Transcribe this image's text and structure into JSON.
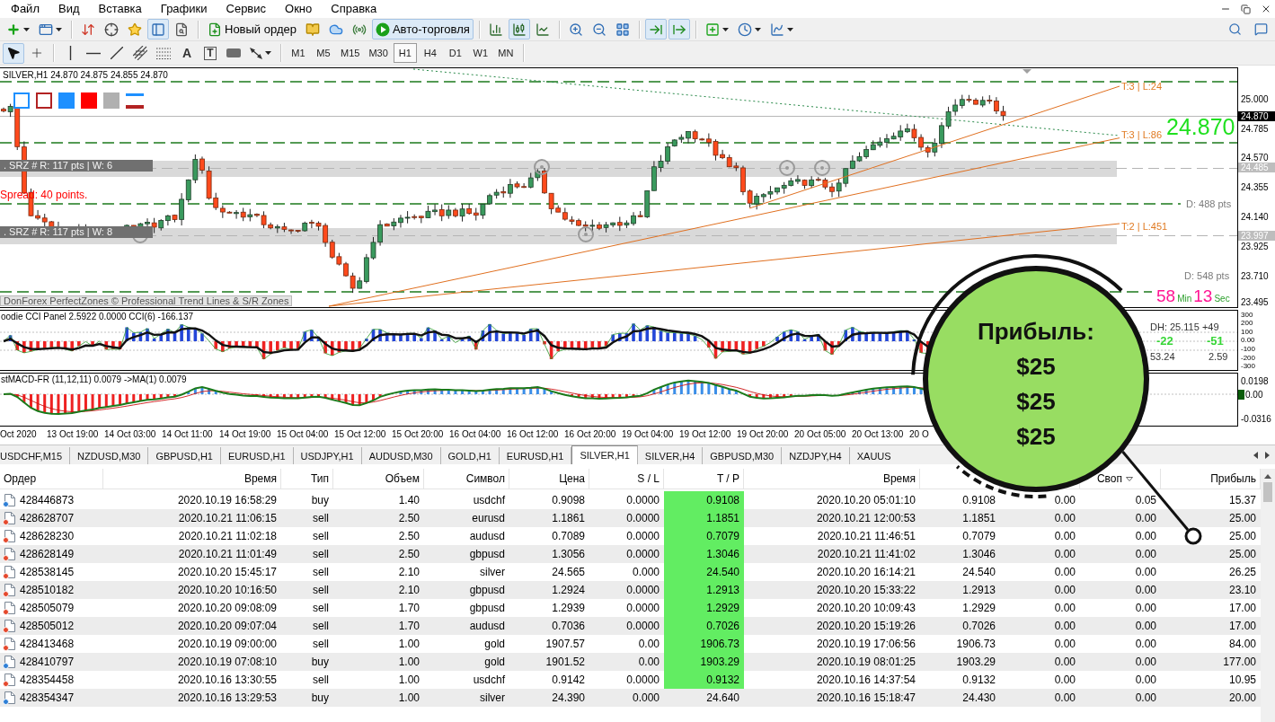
{
  "menu": [
    "Файл",
    "Вид",
    "Вставка",
    "Графики",
    "Сервис",
    "Окно",
    "Справка"
  ],
  "main_toolbar": [
    [
      {
        "kind": "dropdown",
        "pressed": false
      },
      {
        "kind": "dropdown",
        "pressed": false
      }
    ],
    [
      {
        "kind": "icon",
        "pressed": false
      },
      {
        "kind": "icon",
        "pressed": false
      },
      {
        "kind": "icon",
        "pressed": false
      },
      {
        "kind": "icon",
        "pressed": true
      },
      {
        "kind": "icon",
        "pressed": false
      }
    ],
    [
      {
        "kind": "labeled",
        "label": "Новый ордер",
        "pressed": false
      },
      {
        "kind": "icon",
        "pressed": false
      },
      {
        "kind": "icon",
        "pressed": false
      },
      {
        "kind": "icon",
        "pressed": false
      },
      {
        "kind": "labeled",
        "label": "Авто-торговля",
        "pressed": true
      }
    ],
    [
      {
        "kind": "icon",
        "pressed": false
      },
      {
        "kind": "icon",
        "pressed": true
      },
      {
        "kind": "icon",
        "pressed": false
      }
    ],
    [
      {
        "kind": "icon",
        "pressed": false
      },
      {
        "kind": "icon",
        "pressed": false
      },
      {
        "kind": "icon",
        "pressed": false
      }
    ],
    [
      {
        "kind": "icon",
        "pressed": true
      },
      {
        "kind": "icon",
        "pressed": true
      }
    ],
    [
      {
        "kind": "dropdown",
        "pressed": false
      },
      {
        "kind": "dropdown",
        "pressed": false
      },
      {
        "kind": "dropdown",
        "pressed": false
      }
    ]
  ],
  "drawing_toolbar": [
    [
      {
        "kind": "icon",
        "pressed": true
      },
      {
        "kind": "icon",
        "pressed": false
      }
    ],
    [
      {
        "kind": "icon",
        "pressed": false
      },
      {
        "kind": "icon",
        "pressed": false
      },
      {
        "kind": "icon",
        "pressed": false
      },
      {
        "kind": "icon",
        "pressed": false
      },
      {
        "kind": "icon",
        "pressed": false
      },
      {
        "kind": "glyph",
        "label": "A",
        "pressed": false
      },
      {
        "kind": "boxed_glyph",
        "label": "T",
        "pressed": false
      },
      {
        "kind": "icon",
        "pressed": false
      },
      {
        "kind": "dropdown",
        "pressed": false
      }
    ]
  ],
  "timeframes": [
    {
      "label": "M1",
      "selected": false
    },
    {
      "label": "M5",
      "selected": false
    },
    {
      "label": "M15",
      "selected": false
    },
    {
      "label": "M30",
      "selected": false
    },
    {
      "label": "H1",
      "selected": true
    },
    {
      "label": "H4",
      "selected": false
    },
    {
      "label": "D1",
      "selected": false
    },
    {
      "label": "W1",
      "selected": false
    },
    {
      "label": "MN",
      "selected": false
    }
  ],
  "chart": {
    "title": "SILVER,H1 24.870 24.875 24.855 24.870",
    "zones": [
      ". SRZ # R: 117 pts | W: 6",
      ". SRZ # R: 117 pts | W: 8"
    ],
    "spread": "Spread: 40 points.",
    "credit": "DonForex PerfectZones © Professional Trend Lines & S/R Zones",
    "trend_labels": [
      "T:3 | L:24",
      "T:3 | L:86",
      "T:2 | L:451"
    ],
    "current_price": "24.870",
    "distance_labels": [
      "D: 488 pts",
      "D: 548 pts"
    ],
    "countdown": {
      "minutes": "58",
      "minutes_unit": "Min",
      "seconds": "13",
      "seconds_unit": "Sec"
    },
    "price_axis": [
      {
        "label": "25.000",
        "kind": "tick"
      },
      {
        "label": "24.870",
        "kind": "bid"
      },
      {
        "label": "24.785",
        "kind": "tick"
      },
      {
        "label": "24.570",
        "kind": "tick"
      },
      {
        "label": "24.485",
        "kind": "zone"
      },
      {
        "label": "24.355",
        "kind": "tick"
      },
      {
        "label": "24.140",
        "kind": "tick"
      },
      {
        "label": "23.997",
        "kind": "zone"
      },
      {
        "label": "23.925",
        "kind": "tick"
      },
      {
        "label": "23.710",
        "kind": "tick"
      },
      {
        "label": "23.495",
        "kind": "tick"
      }
    ]
  },
  "cci_panel": {
    "title": "oodie CCI Panel 2.5922 0.0000 CCI(6) -166.137",
    "axis": [
      "300",
      "200",
      "100",
      "0.00",
      "-100",
      "-200",
      "-300"
    ],
    "readouts": [
      {
        "text": "DH: 25.115 +49",
        "kind": "plain"
      },
      {
        "text": "-22",
        "kind": "signal"
      },
      {
        "text": "-51",
        "kind": "signal"
      },
      {
        "text": "53.24",
        "kind": "plain"
      },
      {
        "text": "2.59",
        "kind": "plain"
      }
    ]
  },
  "macd_panel": {
    "title": "stMACD-FR (11,12,11) 0.0079 ->MA(1) 0.0079",
    "axis": [
      {
        "label": "0.0198",
        "kind": "tick"
      },
      {
        "label": "0.00",
        "kind": "current"
      },
      {
        "label": "-0.0316",
        "kind": "tick"
      }
    ]
  },
  "time_axis": [
    "Oct 2020",
    "13 Oct 19:00",
    "14 Oct 03:00",
    "14 Oct 11:00",
    "14 Oct 19:00",
    "15 Oct 04:00",
    "15 Oct 12:00",
    "15 Oct 20:00",
    "16 Oct 04:00",
    "16 Oct 12:00",
    "16 Oct 20:00",
    "19 Oct 04:00",
    "19 Oct 12:00",
    "19 Oct 20:00",
    "20 Oct 05:00",
    "20 Oct 13:00",
    "20 O"
  ],
  "chart_tabs": [
    {
      "label": "USDCHF,M15",
      "selected": false
    },
    {
      "label": "NZDUSD,M30",
      "selected": false
    },
    {
      "label": "GBPUSD,H1",
      "selected": false
    },
    {
      "label": "EURUSD,H1",
      "selected": false
    },
    {
      "label": "USDJPY,H1",
      "selected": false
    },
    {
      "label": "AUDUSD,M30",
      "selected": false
    },
    {
      "label": "GOLD,H1",
      "selected": false
    },
    {
      "label": "EURUSD,H1",
      "selected": false
    },
    {
      "label": "SILVER,H1",
      "selected": true
    },
    {
      "label": "SILVER,H4",
      "selected": false
    },
    {
      "label": "GBPUSD,M30",
      "selected": false
    },
    {
      "label": "NZDJPY,H4",
      "selected": false
    },
    {
      "label": "XAUUS",
      "selected": false
    }
  ],
  "orders_table": {
    "columns": [
      {
        "label": "Ордер",
        "sorted": false
      },
      {
        "label": "Время",
        "sorted": false
      },
      {
        "label": "Тип",
        "sorted": false
      },
      {
        "label": "Объем",
        "sorted": false
      },
      {
        "label": "Символ",
        "sorted": false
      },
      {
        "label": "Цена",
        "sorted": false
      },
      {
        "label": "S / L",
        "sorted": false
      },
      {
        "label": "T / P",
        "sorted": false
      },
      {
        "label": "Время",
        "sorted": false
      },
      null,
      null,
      {
        "label": "Своп",
        "sorted": true
      },
      {
        "label": "Прибыль",
        "sorted": false
      }
    ],
    "rows": [
      {
        "cells": [
          "428446873",
          "2020.10.19 16:58:29",
          "buy",
          "1.40",
          "usdchf",
          "0.9098",
          "0.0000",
          "0.9108",
          "2020.10.20 05:01:10",
          "0.9108",
          "0.00",
          "0.05",
          "15.37"
        ],
        "color": "#2e7fd6",
        "tp_hit": true
      },
      {
        "cells": [
          "428628707",
          "2020.10.21 11:06:15",
          "sell",
          "2.50",
          "eurusd",
          "1.1861",
          "0.0000",
          "1.1851",
          "2020.10.21 12:00:53",
          "1.1851",
          "0.00",
          "0.00",
          "25.00"
        ],
        "color": "#e5482c",
        "tp_hit": true
      },
      {
        "cells": [
          "428628230",
          "2020.10.21 11:02:18",
          "sell",
          "2.50",
          "audusd",
          "0.7089",
          "0.0000",
          "0.7079",
          "2020.10.21 11:46:51",
          "0.7079",
          "0.00",
          "0.00",
          "25.00"
        ],
        "color": "#e5482c",
        "tp_hit": true
      },
      {
        "cells": [
          "428628149",
          "2020.10.21 11:01:49",
          "sell",
          "2.50",
          "gbpusd",
          "1.3056",
          "0.0000",
          "1.3046",
          "2020.10.21 11:41:02",
          "1.3046",
          "0.00",
          "0.00",
          "25.00"
        ],
        "color": "#e5482c",
        "tp_hit": true
      },
      {
        "cells": [
          "428538145",
          "2020.10.20 15:45:17",
          "sell",
          "2.10",
          "silver",
          "24.565",
          "0.000",
          "24.540",
          "2020.10.20 16:14:21",
          "24.540",
          "0.00",
          "0.00",
          "26.25"
        ],
        "color": "#e5482c",
        "tp_hit": true
      },
      {
        "cells": [
          "428510182",
          "2020.10.20 10:16:50",
          "sell",
          "2.10",
          "gbpusd",
          "1.2924",
          "0.0000",
          "1.2913",
          "2020.10.20 15:33:22",
          "1.2913",
          "0.00",
          "0.00",
          "23.10"
        ],
        "color": "#e5482c",
        "tp_hit": true
      },
      {
        "cells": [
          "428505079",
          "2020.10.20 09:08:09",
          "sell",
          "1.70",
          "gbpusd",
          "1.2939",
          "0.0000",
          "1.2929",
          "2020.10.20 10:09:43",
          "1.2929",
          "0.00",
          "0.00",
          "17.00"
        ],
        "color": "#e5482c",
        "tp_hit": true
      },
      {
        "cells": [
          "428505012",
          "2020.10.20 09:07:04",
          "sell",
          "1.70",
          "audusd",
          "0.7036",
          "0.0000",
          "0.7026",
          "2020.10.20 15:19:26",
          "0.7026",
          "0.00",
          "0.00",
          "17.00"
        ],
        "color": "#e5482c",
        "tp_hit": true
      },
      {
        "cells": [
          "428413468",
          "2020.10.19 09:00:00",
          "sell",
          "1.00",
          "gold",
          "1907.57",
          "0.00",
          "1906.73",
          "2020.10.19 17:06:56",
          "1906.73",
          "0.00",
          "0.00",
          "84.00"
        ],
        "color": "#e5482c",
        "tp_hit": true
      },
      {
        "cells": [
          "428410797",
          "2020.10.19 07:08:10",
          "buy",
          "1.00",
          "gold",
          "1901.52",
          "0.00",
          "1903.29",
          "2020.10.19 08:01:25",
          "1903.29",
          "0.00",
          "0.00",
          "177.00"
        ],
        "color": "#2e7fd6",
        "tp_hit": true
      },
      {
        "cells": [
          "428354458",
          "2020.10.16 13:30:55",
          "sell",
          "1.00",
          "usdchf",
          "0.9142",
          "0.0000",
          "0.9132",
          "2020.10.16 14:37:54",
          "0.9132",
          "0.00",
          "0.00",
          "10.95"
        ],
        "color": "#e5482c",
        "tp_hit": true
      },
      {
        "cells": [
          "428354347",
          "2020.10.16 13:29:53",
          "buy",
          "1.00",
          "silver",
          "24.390",
          "0.000",
          "24.640",
          "2020.10.16 15:18:47",
          "24.430",
          "0.00",
          "0.00",
          "20.00"
        ],
        "color": "#2e7fd6",
        "tp_hit": false
      }
    ]
  },
  "callout": {
    "title": "Прибыль:",
    "values": [
      "$25",
      "$25",
      "$25"
    ]
  }
}
